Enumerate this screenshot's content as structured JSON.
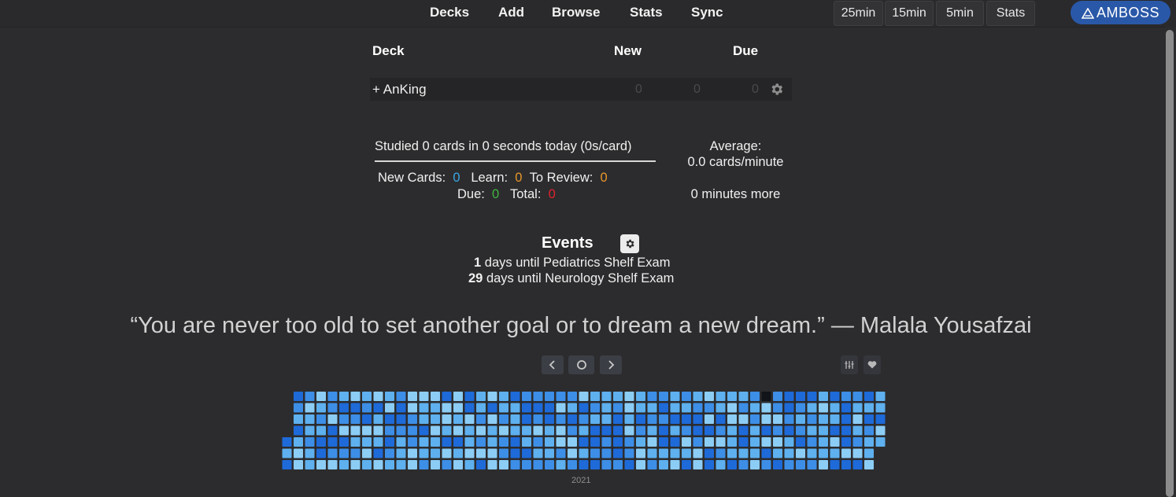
{
  "nav": {
    "decks": "Decks",
    "add": "Add",
    "browse": "Browse",
    "stats": "Stats",
    "sync": "Sync"
  },
  "timers": [
    "25min",
    "15min",
    "5min",
    "Stats"
  ],
  "amboss_label": "AMBOSS",
  "deck_table": {
    "headers": {
      "deck": "Deck",
      "new": "New",
      "due": "Due"
    },
    "rows": [
      {
        "expander": "+",
        "name": "AnKing",
        "counts": [
          "0",
          "0",
          "0"
        ]
      }
    ]
  },
  "today": {
    "studied": "Studied 0 cards in 0 seconds today (0s/card)",
    "new_label": "New Cards:",
    "new_value": "0",
    "learn_label": "Learn:",
    "learn_value": "0",
    "review_label": "To Review:",
    "review_value": "0",
    "due_label": "Due:",
    "due_value": "0",
    "total_label": "Total:",
    "total_value": "0",
    "average_label": "Average:",
    "average_value": "0.0 cards/minute",
    "minutes_more": "0 minutes more"
  },
  "events": {
    "title": "Events",
    "items": [
      {
        "days": "1",
        "text": " days until Pediatrics Shelf Exam"
      },
      {
        "days": "29",
        "text": " days until Neurology Shelf Exam"
      }
    ]
  },
  "quote": "“You are never too old to set another goal or to dream a new dream.” — Malala Yousafzai",
  "heatmap": {
    "year_label": "2021",
    "palette": [
      "#8ccdf5",
      "#5eb0ee",
      "#3d8ee6",
      "#1e6ad8",
      "#111418"
    ],
    "empty_cell": [
      41,
      0
    ]
  },
  "colors": {
    "background": "#2c2c2e",
    "new": "#3aa6e6",
    "learn": "#e8962a",
    "due": "#3fb53f",
    "total": "#e0242a",
    "accent": "#2a58a8"
  },
  "icons": {
    "deck_options": "gear-icon",
    "events_options": "gear-icon",
    "prev": "chevron-left-icon",
    "today": "circle-icon",
    "next": "chevron-right-icon",
    "settings": "sliders-icon",
    "favorite": "heart-icon"
  }
}
